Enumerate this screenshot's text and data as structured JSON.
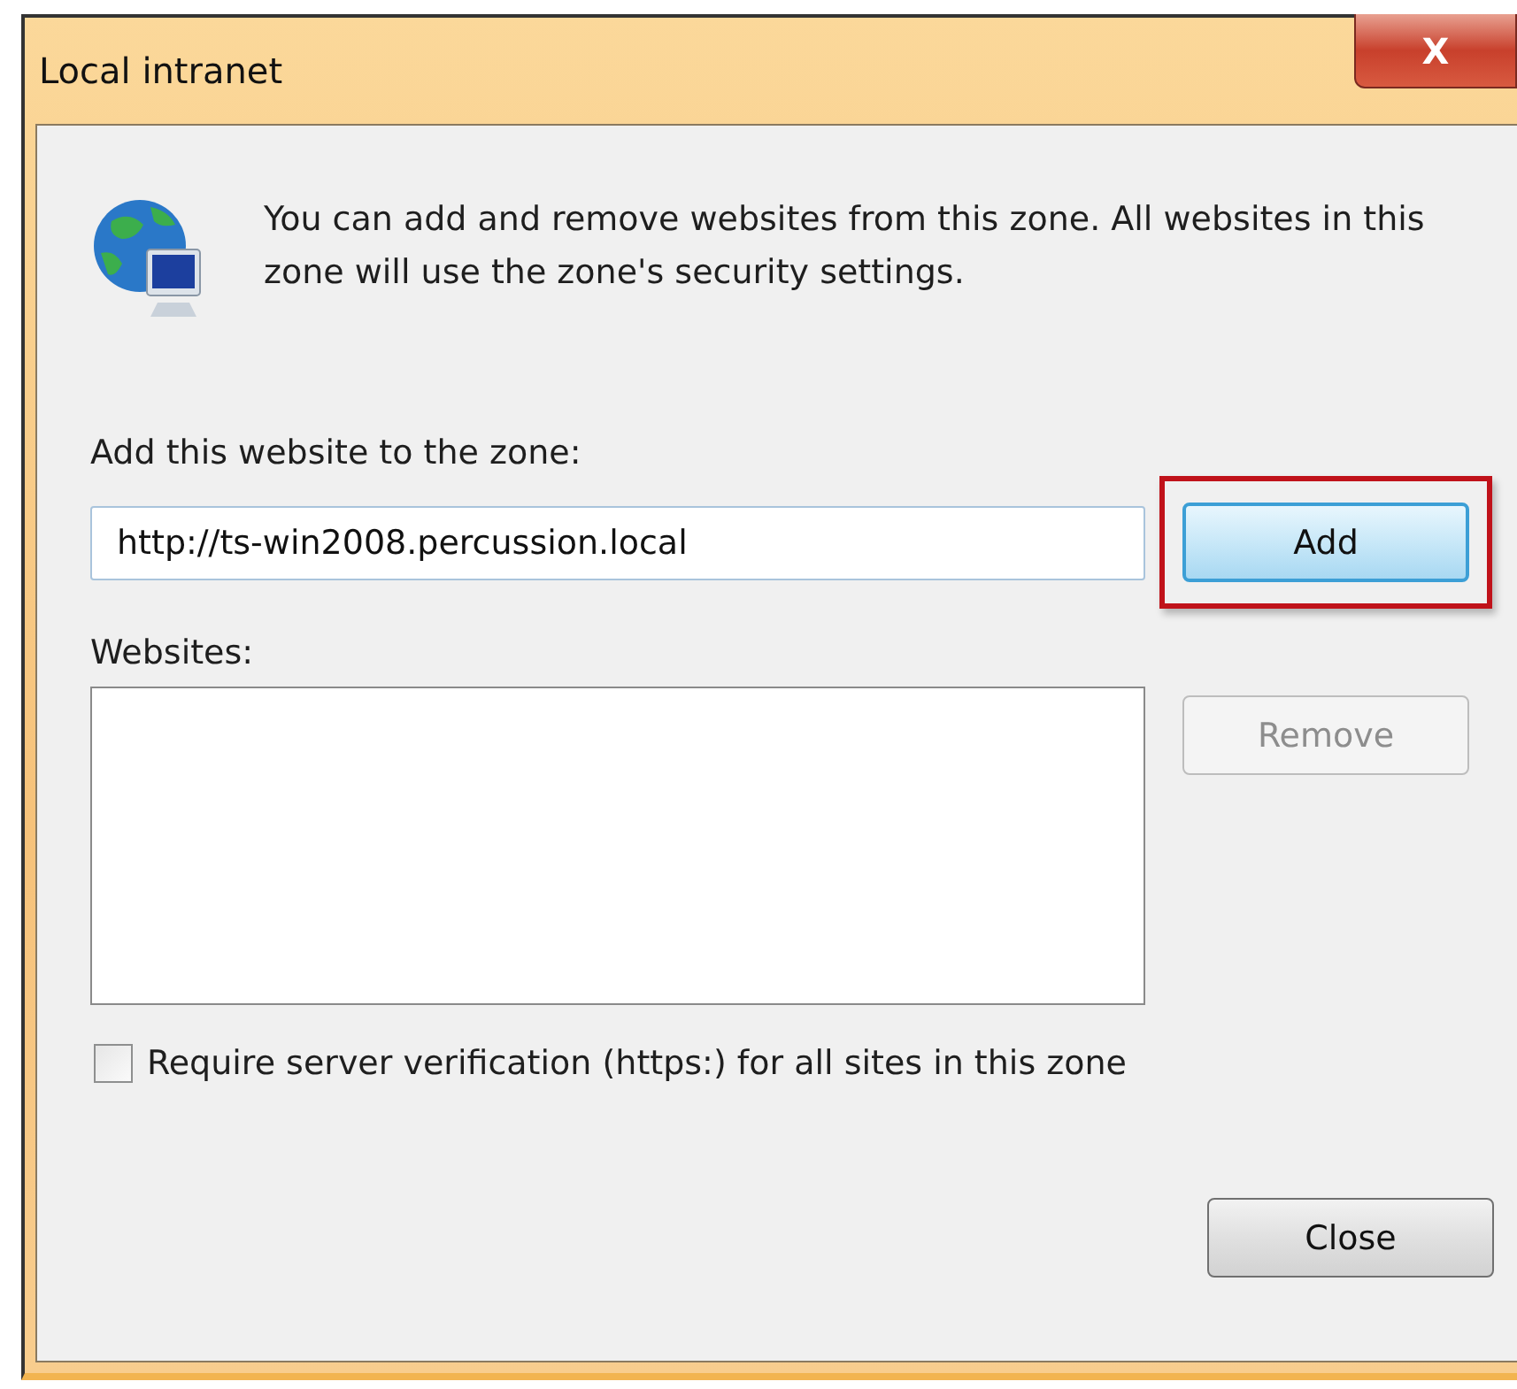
{
  "window": {
    "title": "Local intranet",
    "close_glyph": "X"
  },
  "intro": "You can add and remove websites from this zone. All websites in this zone will use the zone's security settings.",
  "add_field": {
    "label": "Add this website to the zone:",
    "value": "http://ts-win2008.percussion.local"
  },
  "buttons": [
    {
      "label": "Add",
      "kind": "add",
      "disabled": false,
      "focused": true,
      "highlighted": true
    },
    {
      "label": "Remove",
      "kind": "remove",
      "disabled": true,
      "focused": false,
      "highlighted": false
    },
    {
      "label": "Close",
      "kind": "close",
      "disabled": false,
      "focused": false,
      "highlighted": false
    }
  ],
  "websites": {
    "label": "Websites:"
  },
  "require_https": {
    "label": "Require server verification (https:) for all sites in this zone",
    "checked": false
  }
}
